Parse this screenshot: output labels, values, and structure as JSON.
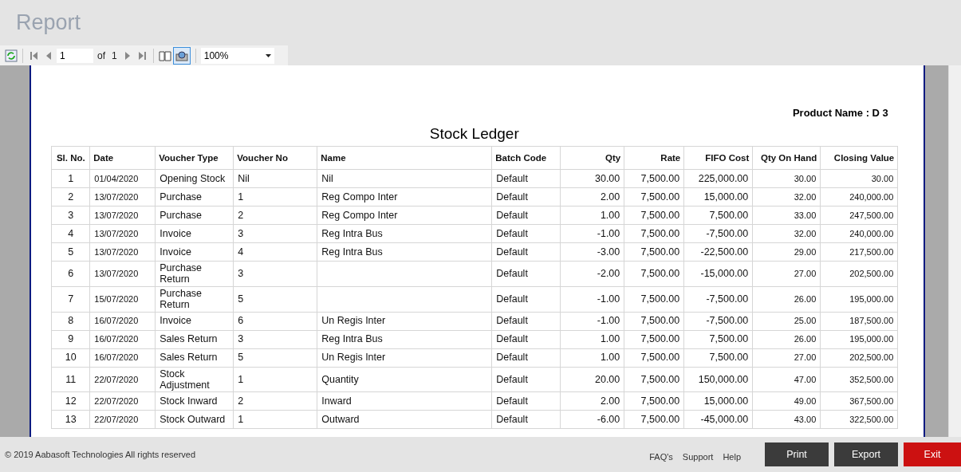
{
  "window": {
    "title": "Report"
  },
  "toolbar": {
    "page": "1",
    "of_label": "of",
    "total_pages": "1",
    "zoom": "100%",
    "layout_selected": true
  },
  "report": {
    "product_label": "Product Name : D 3",
    "title": "Stock Ledger",
    "columns": [
      "Sl. No.",
      "Date",
      "Voucher Type",
      "Voucher No",
      "Name",
      "Batch Code",
      "Qty",
      "Rate",
      "FIFO Cost",
      "Qty On Hand",
      "Closing Value"
    ],
    "rows": [
      [
        "1",
        "01/04/2020",
        "Opening Stock",
        "Nil",
        "Nil",
        "Default",
        "30.00",
        "7,500.00",
        "225,000.00",
        "30.00",
        "30.00"
      ],
      [
        "2",
        "13/07/2020",
        "Purchase",
        "1",
        "Reg Compo Inter",
        "Default",
        "2.00",
        "7,500.00",
        "15,000.00",
        "32.00",
        "240,000.00"
      ],
      [
        "3",
        "13/07/2020",
        "Purchase",
        "2",
        "Reg Compo Inter",
        "Default",
        "1.00",
        "7,500.00",
        "7,500.00",
        "33.00",
        "247,500.00"
      ],
      [
        "4",
        "13/07/2020",
        "Invoice",
        "3",
        "Reg Intra Bus",
        "Default",
        "-1.00",
        "7,500.00",
        "-7,500.00",
        "32.00",
        "240,000.00"
      ],
      [
        "5",
        "13/07/2020",
        "Invoice",
        "4",
        "Reg Intra Bus",
        "Default",
        "-3.00",
        "7,500.00",
        "-22,500.00",
        "29.00",
        "217,500.00"
      ],
      [
        "6",
        "13/07/2020",
        "Purchase Return",
        "3",
        "",
        "Default",
        "-2.00",
        "7,500.00",
        "-15,000.00",
        "27.00",
        "202,500.00"
      ],
      [
        "7",
        "15/07/2020",
        "Purchase Return",
        "5",
        "",
        "Default",
        "-1.00",
        "7,500.00",
        "-7,500.00",
        "26.00",
        "195,000.00"
      ],
      [
        "8",
        "16/07/2020",
        "Invoice",
        "6",
        "Un Regis Inter",
        "Default",
        "-1.00",
        "7,500.00",
        "-7,500.00",
        "25.00",
        "187,500.00"
      ],
      [
        "9",
        "16/07/2020",
        "Sales Return",
        "3",
        "Reg Intra Bus",
        "Default",
        "1.00",
        "7,500.00",
        "7,500.00",
        "26.00",
        "195,000.00"
      ],
      [
        "10",
        "16/07/2020",
        "Sales Return",
        "5",
        "Un Regis Inter",
        "Default",
        "1.00",
        "7,500.00",
        "7,500.00",
        "27.00",
        "202,500.00"
      ],
      [
        "11",
        "22/07/2020",
        "Stock Adjustment",
        "1",
        "Quantity",
        "Default",
        "20.00",
        "7,500.00",
        "150,000.00",
        "47.00",
        "352,500.00"
      ],
      [
        "12",
        "22/07/2020",
        "Stock Inward",
        "2",
        "Inward",
        "Default",
        "2.00",
        "7,500.00",
        "15,000.00",
        "49.00",
        "367,500.00"
      ],
      [
        "13",
        "22/07/2020",
        "Stock Outward",
        "1",
        "Outward",
        "Default",
        "-6.00",
        "7,500.00",
        "-45,000.00",
        "43.00",
        "322,500.00"
      ]
    ]
  },
  "footer": {
    "copyright": "© 2019 Aabasoft Technologies All rights reserved",
    "links": [
      "FAQ's",
      "Support",
      "Help"
    ],
    "buttons": [
      {
        "label": "Print",
        "kind": "dark"
      },
      {
        "label": "Export",
        "kind": "dark"
      },
      {
        "label": "Exit",
        "kind": "danger"
      }
    ]
  }
}
